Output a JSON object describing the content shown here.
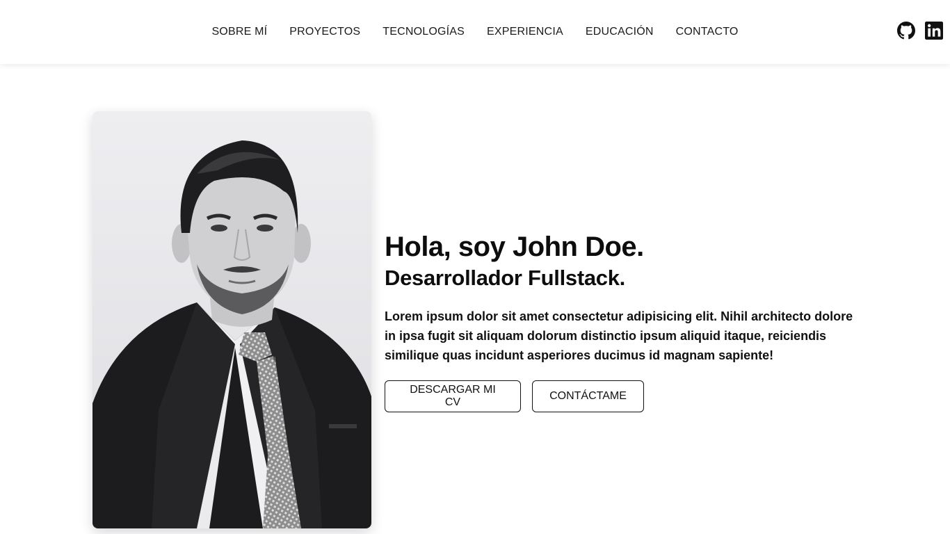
{
  "nav": {
    "items": [
      {
        "label": "SOBRE MÍ"
      },
      {
        "label": "PROYECTOS"
      },
      {
        "label": "TECNOLOGÍAS"
      },
      {
        "label": "EXPERIENCIA"
      },
      {
        "label": "EDUCACIÓN"
      },
      {
        "label": "CONTACTO"
      }
    ]
  },
  "social": {
    "icons": [
      "github-icon",
      "linkedin-icon"
    ]
  },
  "hero": {
    "photo_icon": "profile-photo",
    "title": "Hola, soy John Doe.",
    "subtitle": "Desarrollador Fullstack.",
    "description": "Lorem ipsum dolor sit amet consectetur adipisicing elit. Nihil architecto dolore in ipsa fugit sit aliquam dolorum distinctio ipsum aliquid itaque, reiciendis similique quas incidunt asperiores ducimus id magnam sapiente!",
    "buttons": {
      "cv": "DESCARGAR MI CV",
      "contact": "CONTÁCTAME"
    }
  },
  "colors": {
    "text": "#111111",
    "background": "#ffffff",
    "border": "#111111"
  }
}
